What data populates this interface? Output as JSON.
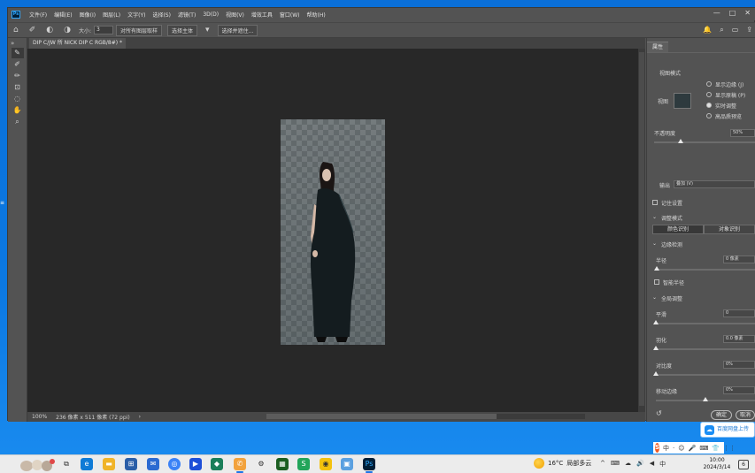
{
  "app": {
    "logo": "Ps",
    "menu": [
      "文件(F)",
      "编辑(E)",
      "图像(I)",
      "图层(L)",
      "文字(Y)",
      "选择(S)",
      "滤镜(T)",
      "3D(D)",
      "视图(V)",
      "增效工具",
      "窗口(W)",
      "帮助(H)"
    ],
    "window_controls": [
      "—",
      "□",
      "✕"
    ]
  },
  "options_bar": {
    "size_label": "大小:",
    "size_value": "3",
    "btn_sample": "对所有图层取样",
    "btn_select_subject": "选择主体",
    "btn_select_mask": "选择并遮住..."
  },
  "document": {
    "tab_title": "DIP C/JW 所 NICK DIP C RGB/8#) *"
  },
  "status": {
    "zoom": "100%",
    "doc_info": "236 像素 x 511 像素 (72 ppi)"
  },
  "panel": {
    "tab_label": "属性",
    "section_view_mode": "视图模式",
    "view_label": "视图",
    "view_options": [
      "显示边缘 (J)",
      "显示原稿 (P)",
      "实时调整",
      "高品质预览"
    ],
    "opacity_label": "不透明度",
    "opacity_value": "50%",
    "output_label": "输出",
    "output_value": "叠加 (V)",
    "refine_mode_label": "记住设置",
    "section_refine": "调整模式",
    "refine_btn_1": "颜色识别",
    "refine_btn_2": "对象识别",
    "section_edge": "边缘检测",
    "radius_label": "半径",
    "radius_value": "0 像素",
    "smart_radius_label": "智能半径",
    "section_global": "全局调整",
    "smooth_label": "平滑",
    "smooth_value": "0",
    "feather_label": "羽化",
    "feather_value": "0.0 像素",
    "contrast_label": "对比度",
    "contrast_value": "0%",
    "shift_edge_label": "移动边缘",
    "shift_edge_value": "0%",
    "smooth_level": 0,
    "feather_level": 0,
    "contrast_level": 0,
    "shift_edge_level": 0.5,
    "opacity_level": 0.5,
    "ok_label": "确定",
    "cancel_label": "取消"
  },
  "overlay": {
    "cloud_btn": "百度网盘上传"
  },
  "ime": {
    "logo": "S",
    "items": [
      "中",
      "·",
      "☺",
      "🎤",
      "⌨",
      "👕",
      "⋮⋮"
    ]
  },
  "taskbar": {
    "weather_temp": "16°C",
    "weather_text": "局部多云",
    "tray": [
      "^",
      "⌨",
      "☁",
      "🔊",
      "◀",
      "中"
    ],
    "time": "10:00",
    "date": "2024/3/14",
    "notify_count": "6"
  }
}
